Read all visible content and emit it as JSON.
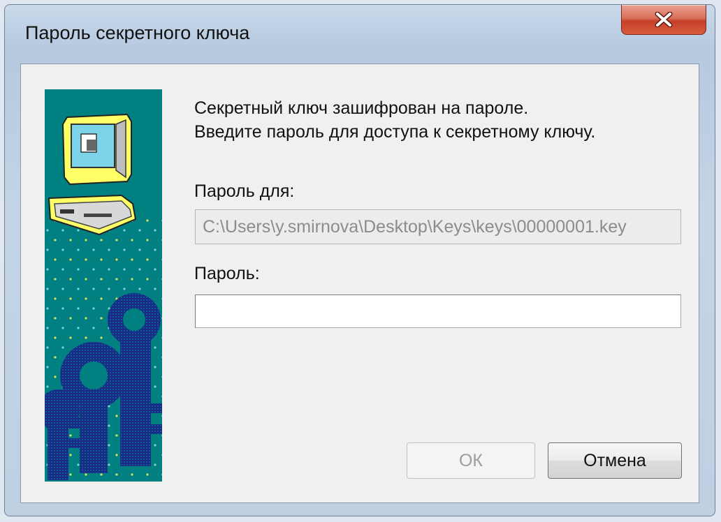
{
  "window": {
    "title": "Пароль секретного ключа",
    "close_icon": "close-icon"
  },
  "message": {
    "line1": "Секретный ключ зашифрован на пароле.",
    "line2": "Введите пароль для доступа к секретному ключу."
  },
  "path": {
    "label": "Пароль для:",
    "value": "C:\\Users\\y.smirnova\\Desktop\\Keys\\keys\\00000001.key"
  },
  "password": {
    "label": "Пароль:",
    "value": ""
  },
  "buttons": {
    "ok_label": "ОК",
    "cancel_label": "Отмена"
  },
  "colors": {
    "side_art_bg": "#008080",
    "close_button": "#c7402a"
  },
  "icons": {
    "side_art": "computer-with-keys-illustration"
  }
}
